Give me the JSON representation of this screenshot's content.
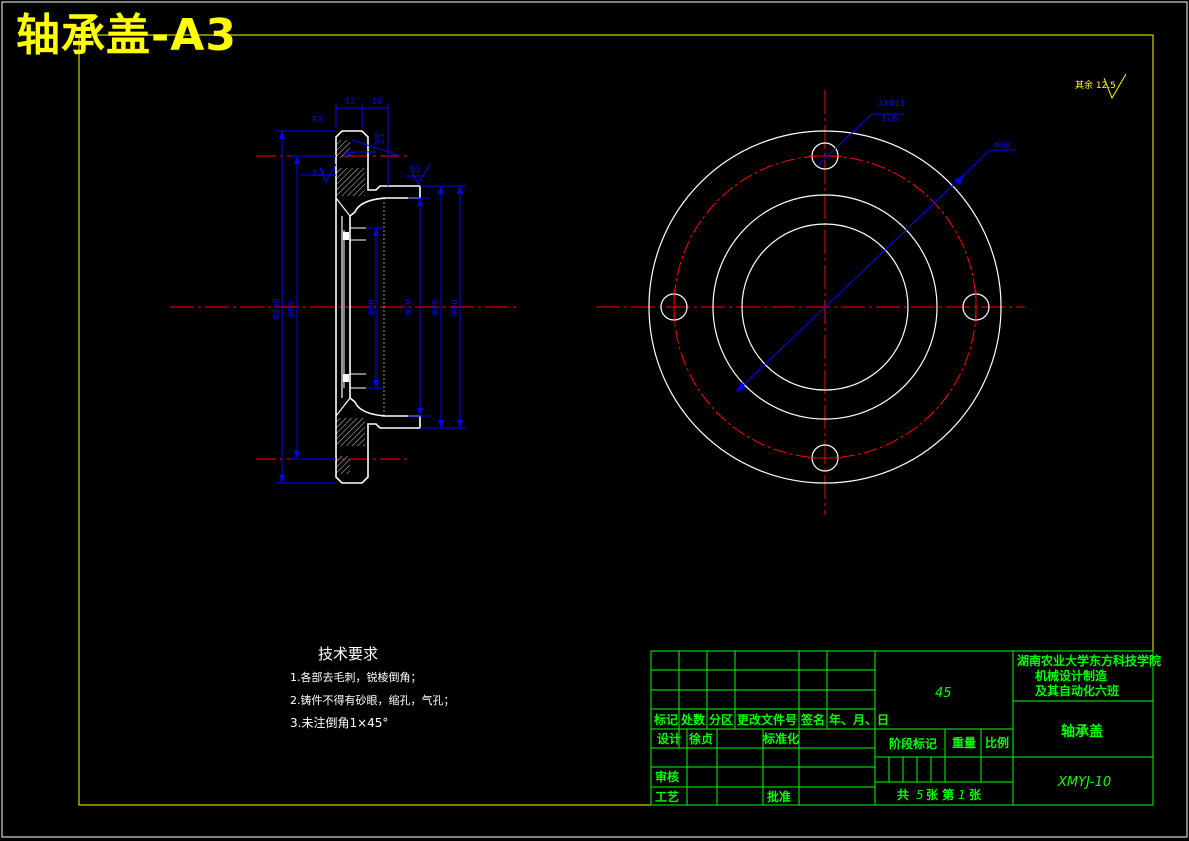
{
  "title": "轴承盖-A3",
  "roughness_note": "其余 12.5",
  "section_view": {
    "dims_top": [
      "12",
      "16"
    ],
    "r3": "R3",
    "c1": "C1",
    "r1_left": "R1",
    "r1_small": "3.2",
    "r1_right": "R1",
    "diameters_left": [
      "Φ100",
      "Φ80"
    ],
    "diameters_right": [
      "Φ60",
      "Φ70",
      "Φ75",
      "Φ80"
    ]
  },
  "front_view": {
    "hole_label": "4XΦ11",
    "hole_label2": "EQS",
    "pcd_label": "Φ60"
  },
  "tech_requirements": {
    "heading": "技术要求",
    "items": [
      "1.各部去毛刺，锐棱倒角；",
      "2.铸件不得有砂眼，缩孔，气孔；",
      "3.未注倒角1×45°"
    ]
  },
  "title_block": {
    "material": "45",
    "school": [
      "湖南农业大学东方科技学院",
      "机械设计制造",
      "及其自动化六班"
    ],
    "part_name": "轴承盖",
    "drawing_no": "XMYJ-10",
    "header_row": [
      "标记",
      "处数",
      "分区",
      "更改文件号",
      "签名",
      "年、月、日"
    ],
    "design_label": "设计",
    "designer": "徐贞",
    "standardize_label": "标准化",
    "stage_label": "阶段标记",
    "weight_label": "重量",
    "scale_label": "比例",
    "review_label": "审核",
    "process_label": "工艺",
    "approve_label": "批准",
    "sheets_total_prefix": "共",
    "sheets_total": "5",
    "sheets_mid": "张 第",
    "sheet_no": "1",
    "sheets_suffix": "张"
  },
  "colors": {
    "background": "#000000",
    "frame": "#ffff00",
    "outline": "#ffffff",
    "dimension": "#0000ff",
    "centerline": "#ff0000",
    "title_block": "#00ff00"
  }
}
